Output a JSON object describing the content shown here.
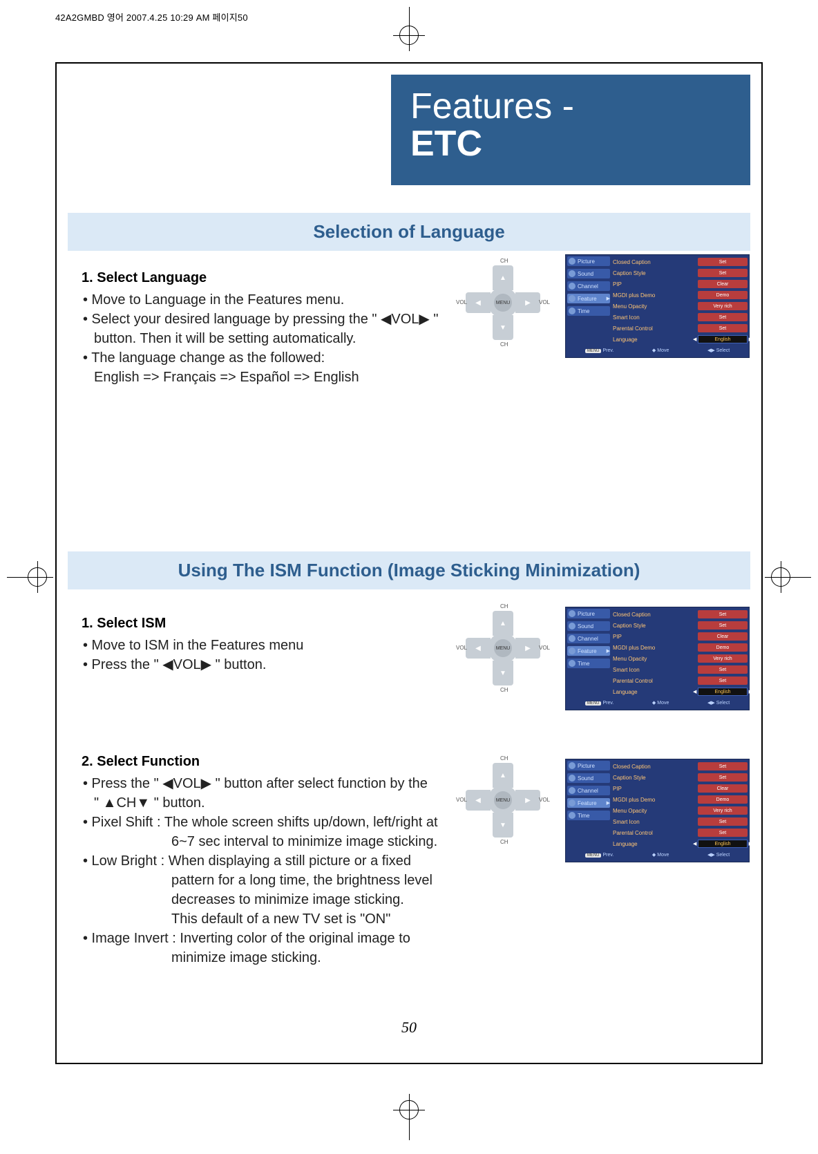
{
  "header_text": "42A2GMBD 영어  2007.4.25 10:29 AM 페이지50",
  "title_line1": "Features -",
  "title_line2": "ETC",
  "section1_header": "Selection of Language",
  "section2_header": "Using The ISM Function (Image Sticking Minimization)",
  "step1": {
    "title": "1. Select Language",
    "b1": "• Move to Language in the Features menu.",
    "b2a": "• Select your desired language by pressing the \" ◀VOL▶ \"",
    "b2b": "button. Then it will be setting automatically.",
    "b3a": "• The language change as the followed:",
    "b3b": "English => Français => Español => English"
  },
  "step2": {
    "title": "1. Select ISM",
    "b1": "• Move to ISM in the Features menu",
    "b2": "• Press the  \" ◀VOL▶ \" button."
  },
  "step3": {
    "title": "2. Select Function",
    "b1a": "• Press the \" ◀VOL▶ \" button after select function by the",
    "b1b": "\" ▲CH▼ \" button.",
    "b2a": "• Pixel Shift : The whole screen shifts up/down, left/right at",
    "b2b": "6~7 sec interval to minimize image sticking.",
    "b3a": "• Low Bright : When displaying a still picture or a fixed",
    "b3b": "pattern for a long time, the brightness level",
    "b3c": "decreases to minimize image sticking.",
    "b3d": "This default of a new TV set is \"ON\"",
    "b4a": "• Image Invert : Inverting color of the original image to",
    "b4b": "minimize image sticking."
  },
  "dpad": {
    "center": "MENU",
    "ch": "CH",
    "vol": "VOL"
  },
  "osd": {
    "cats": [
      "Picture",
      "Sound",
      "Channel",
      "Feature",
      "Time"
    ],
    "items": [
      {
        "name": "Closed Caption",
        "val": "Set"
      },
      {
        "name": "Caption Style",
        "val": "Set"
      },
      {
        "name": "PIP",
        "val": "Clear"
      },
      {
        "name": "MGDI plus Demo",
        "val": "Demo"
      },
      {
        "name": "Menu Opacity",
        "val": "Very rich"
      },
      {
        "name": "Smart Icon",
        "val": "Set"
      },
      {
        "name": "Parental Control",
        "val": "Set"
      },
      {
        "name": "Language",
        "val": "English"
      }
    ],
    "footer_prev_btn": "MENU",
    "footer_prev": "Prev.",
    "footer_move": "Move",
    "footer_select": "Select"
  },
  "page_number": "50"
}
